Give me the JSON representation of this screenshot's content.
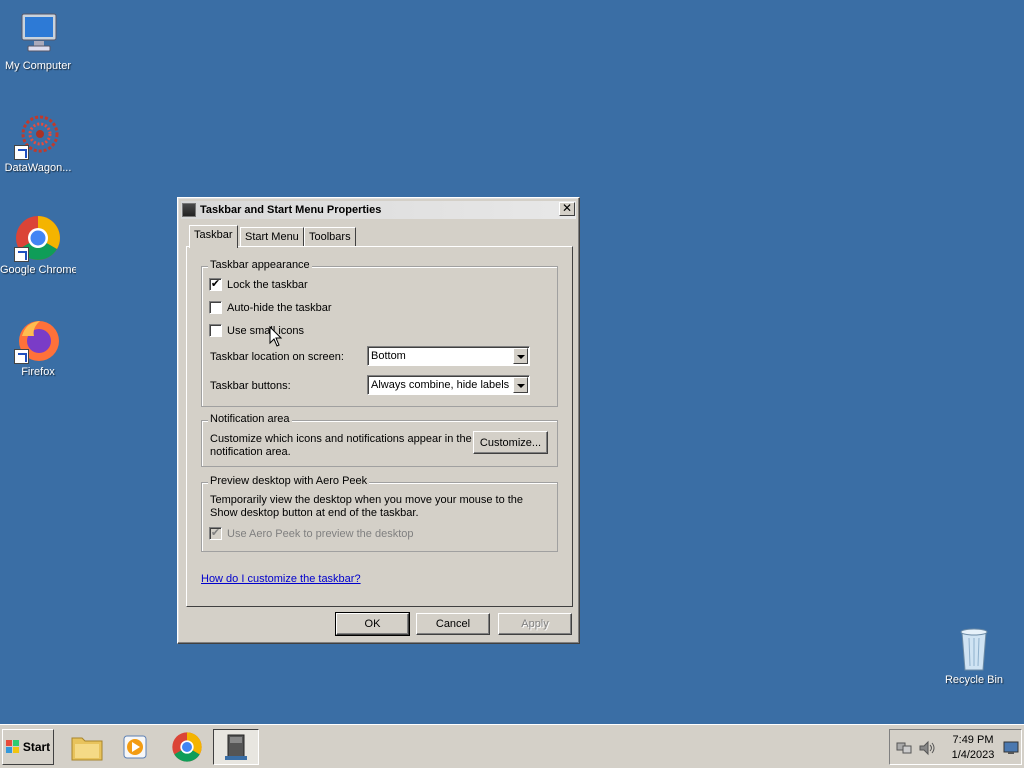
{
  "desktop": {
    "icons": [
      {
        "label": "My Computer",
        "icon": "my-computer-icon"
      },
      {
        "label": "DataWagon...",
        "icon": "datawagon-icon"
      },
      {
        "label": "Google Chrome",
        "icon": "chrome-icon"
      },
      {
        "label": "Firefox",
        "icon": "firefox-icon"
      },
      {
        "label": "Recycle Bin",
        "icon": "recycle-bin-icon"
      }
    ],
    "background": "#3a6ea5"
  },
  "dialog": {
    "title": "Taskbar and Start Menu Properties",
    "close": "✕",
    "tabs": [
      "Taskbar",
      "Start Menu",
      "Toolbars"
    ],
    "active_tab": "Taskbar",
    "appearance": {
      "legend": "Taskbar appearance",
      "lock_label": "Lock the taskbar",
      "lock_checked": true,
      "autohide_label": "Auto-hide the taskbar",
      "autohide_checked": false,
      "small_icons_label": "Use small icons",
      "small_icons_checked": false,
      "location_label": "Taskbar location on screen:",
      "location_value": "Bottom",
      "buttons_label": "Taskbar buttons:",
      "buttons_value": "Always combine, hide labels"
    },
    "notification": {
      "legend": "Notification area",
      "text": "Customize which icons and notifications appear in the notification area.",
      "customize_label": "Customize..."
    },
    "aero_peek": {
      "legend": "Preview desktop with Aero Peek",
      "text": "Temporarily view the desktop when you move your mouse to the Show desktop button at end of the taskbar.",
      "checkbox_label": "Use Aero Peek to preview the desktop",
      "checkbox_checked": true,
      "checkbox_disabled": true
    },
    "help_link": "How do I customize the taskbar?",
    "buttons": {
      "ok": "OK",
      "cancel": "Cancel",
      "apply": "Apply"
    }
  },
  "taskbar": {
    "start_label": "Start",
    "apps": [
      "explorer-icon",
      "media-player-icon",
      "chrome-icon",
      "taskbar-properties-icon"
    ],
    "clock_time": "7:49 PM",
    "clock_date": "1/4/2023"
  }
}
